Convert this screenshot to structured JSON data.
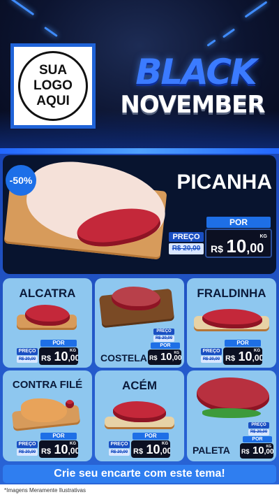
{
  "header": {
    "logo_line1": "SUA",
    "logo_line2": "LOGO",
    "logo_line3": "AQUI",
    "title_line1": "BLACK",
    "title_line2": "NOVEMBER"
  },
  "hero": {
    "discount": "-50%",
    "name": "PICANHA",
    "preco_label": "PREÇO",
    "old_price": "R$ 20,00",
    "por_label": "POR",
    "currency": "R$",
    "price_int": "10",
    "price_dec": ",00",
    "unit": "KG"
  },
  "products": [
    {
      "name": "ALCATRA",
      "preco_label": "PREÇO",
      "old_price": "R$ 20,00",
      "por_label": "POR",
      "currency": "R$",
      "price_int": "10",
      "price_dec": ",00",
      "unit": "KG"
    },
    {
      "name": "COSTELA",
      "preco_label": "PREÇO",
      "old_price": "R$ 20,00",
      "por_label": "POR",
      "currency": "R$",
      "price_int": "10",
      "price_dec": ",00",
      "unit": "KG"
    },
    {
      "name": "FRALDINHA",
      "preco_label": "PREÇO",
      "old_price": "R$ 20,00",
      "por_label": "POR",
      "currency": "R$",
      "price_int": "10",
      "price_dec": ",00",
      "unit": "KG"
    },
    {
      "name": "CONTRA FILÉ",
      "preco_label": "PREÇO",
      "old_price": "R$ 20,00",
      "por_label": "POR",
      "currency": "R$",
      "price_int": "10",
      "price_dec": ",00",
      "unit": "KG"
    },
    {
      "name": "ACÉM",
      "preco_label": "PREÇO",
      "old_price": "R$ 20,00",
      "por_label": "POR",
      "currency": "R$",
      "price_int": "10",
      "price_dec": ",00",
      "unit": "KG"
    },
    {
      "name": "PALETA",
      "preco_label": "PREÇO",
      "old_price": "R$ 20,00",
      "por_label": "POR",
      "currency": "R$",
      "price_int": "10",
      "price_dec": ",00",
      "unit": "KG"
    }
  ],
  "cta": "Crie seu encarte com este tema!",
  "disclaimer": "*Imagens Meramente Ilustrativas",
  "colors": {
    "accent": "#1e6fe6",
    "card": "#8ec7ef",
    "hero_bg": "#08142f"
  }
}
